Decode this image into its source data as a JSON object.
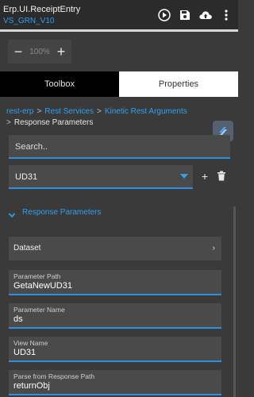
{
  "header": {
    "title": "Erp.UI.ReceiptEntry",
    "subtitle": "VS_GRN_V10",
    "icons": [
      "play-icon",
      "save-icon",
      "cloud-upload-icon",
      "more-vert-icon"
    ]
  },
  "zoom": {
    "minus": "−",
    "value": "100%",
    "plus": "+"
  },
  "tabs": [
    {
      "label": "Toolbox",
      "active": true
    },
    {
      "label": "Properties",
      "active": false
    }
  ],
  "breadcrumb": {
    "items": [
      "rest-erp",
      "Rest Services",
      "Kinetic Rest Arguments"
    ],
    "separator": ">",
    "current": "Response Parameters"
  },
  "search": {
    "placeholder": "Search.."
  },
  "select": {
    "value": "UD31",
    "add": "+"
  },
  "section": {
    "title": "Response Parameters"
  },
  "dataset": {
    "label": "Dataset",
    "arrow": "›"
  },
  "fields": [
    {
      "label": "Parameter Path",
      "value": "GetaNewUD31"
    },
    {
      "label": "Parameter Name",
      "value": "ds"
    },
    {
      "label": "View Name",
      "value": "UD31"
    },
    {
      "label": "Parse from Response Path",
      "value": "returnObj"
    }
  ],
  "colors": {
    "accent": "#2f9ff0",
    "panel": "#3a3a3a",
    "input": "#4a4a4a"
  }
}
